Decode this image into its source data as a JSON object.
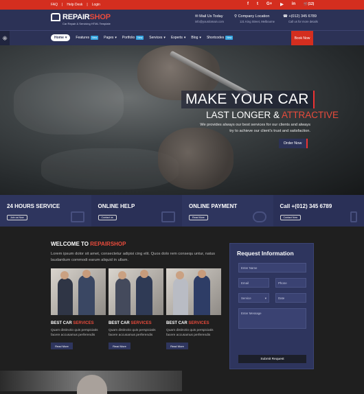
{
  "topbar": {
    "links": [
      "FAQ",
      "Help Desk",
      "Login"
    ],
    "social": [
      "f",
      "t",
      "G+",
      "▶",
      "in"
    ],
    "cart": "(12)"
  },
  "header": {
    "brand_a": "REPAIR",
    "brand_b": "SHOP",
    "tagline": "Car Repair & Servicing HTML Template",
    "contact": [
      {
        "title": "Mail Us Today",
        "sub": "info@yourdomain.com",
        "icon": "mail-icon"
      },
      {
        "title": "Company Location",
        "sub": "121 King Street, Melbourne",
        "icon": "location-icon"
      },
      {
        "title": "+(012) 345 6789",
        "sub": "Call us for more details",
        "icon": "phone-icon"
      }
    ]
  },
  "nav": {
    "items": [
      {
        "label": "Home",
        "badge": ""
      },
      {
        "label": "Features",
        "badge": "New"
      },
      {
        "label": "Pages",
        "badge": ""
      },
      {
        "label": "Portfolio",
        "badge": "New"
      },
      {
        "label": "Services",
        "badge": ""
      },
      {
        "label": "Experts",
        "badge": ""
      },
      {
        "label": "Blog",
        "badge": ""
      },
      {
        "label": "Shortcodes",
        "badge": "New"
      }
    ],
    "book": "Book Now"
  },
  "hero": {
    "title": "MAKE YOUR CAR",
    "sub_a": "LAST LONGER & ",
    "sub_b": "ATTRACTIVE",
    "desc": "We provides always our best services for our clients and always try to achieve our client's trust and satisfaction.",
    "button": "Order Now"
  },
  "features": [
    {
      "title": "24 HOURS SERVICE",
      "button": "Join us Now",
      "icon": "wrench-icon"
    },
    {
      "title": "ONLINE HELP",
      "button": "Contact us",
      "icon": "monitor-icon"
    },
    {
      "title": "ONLINE PAYMENT",
      "button": "Read More",
      "icon": "paypal-icon"
    },
    {
      "title": "Call +(012) 345 6789",
      "button": "Contact Now",
      "icon": "mobile-icon"
    }
  ],
  "welcome": {
    "title_a": "WELCOME TO ",
    "title_b": "REPAIRSHOP",
    "text": "Lorem ipsum dolor sit amet, consectetur adipisi cing elit. Quos dolo rem consequ untur, natus laudantium commodi earum aliquid in ullam."
  },
  "cards": [
    {
      "title_a": "BEST CAR ",
      "title_b": "SERVICES",
      "text": "Quam distinctio quis perspiciatis facere accusamus perferendis",
      "button": "Read More"
    },
    {
      "title_a": "BEST CAR ",
      "title_b": "SERVICES",
      "text": "Quam distinctio quis perspiciatis facere accusamus perferendis",
      "button": "Read More"
    },
    {
      "title_a": "BEST CAR ",
      "title_b": "SERVICES",
      "text": "Quam distinctio quis perspiciatis facere accusamus perferendis",
      "button": "Read More"
    }
  ],
  "form": {
    "title": "Request Information",
    "name": "Enter Name",
    "email": "Email",
    "phone": "Phone",
    "service": "Service",
    "date": "Date",
    "message": "Enter Message",
    "submit": "Submit Request"
  },
  "colors": {
    "accent": "#d42e1f",
    "navy": "#2c3256",
    "panel": "#2e355e"
  }
}
